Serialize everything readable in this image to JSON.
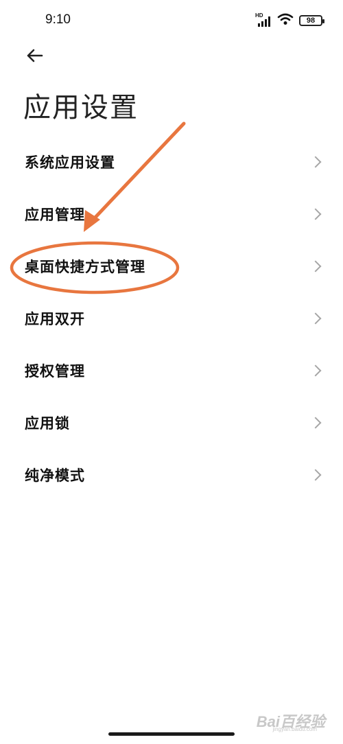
{
  "status_bar": {
    "time": "9:10",
    "network_label": "HD",
    "battery_level": "98",
    "icons": [
      "hd-signal-icon",
      "wifi-icon",
      "battery-icon"
    ]
  },
  "header": {
    "back_icon": "back-arrow-icon",
    "title": "应用设置"
  },
  "settings": {
    "items": [
      {
        "label": "系统应用设置",
        "icon": "chevron-right-icon"
      },
      {
        "label": "应用管理",
        "icon": "chevron-right-icon"
      },
      {
        "label": "桌面快捷方式管理",
        "icon": "chevron-right-icon"
      },
      {
        "label": "应用双开",
        "icon": "chevron-right-icon"
      },
      {
        "label": "授权管理",
        "icon": "chevron-right-icon"
      },
      {
        "label": "应用锁",
        "icon": "chevron-right-icon"
      },
      {
        "label": "纯净模式",
        "icon": "chevron-right-icon"
      }
    ]
  },
  "annotation": {
    "highlighted_item": "桌面快捷方式管理",
    "color": "#E8763F"
  },
  "watermark": {
    "text": "Bai百经验",
    "sub_text": "jingyan.baidu.com"
  },
  "colors": {
    "background": "#FFFFFF",
    "text": "#111111",
    "chevron": "#A6A6A6",
    "annotation": "#E8763F"
  }
}
